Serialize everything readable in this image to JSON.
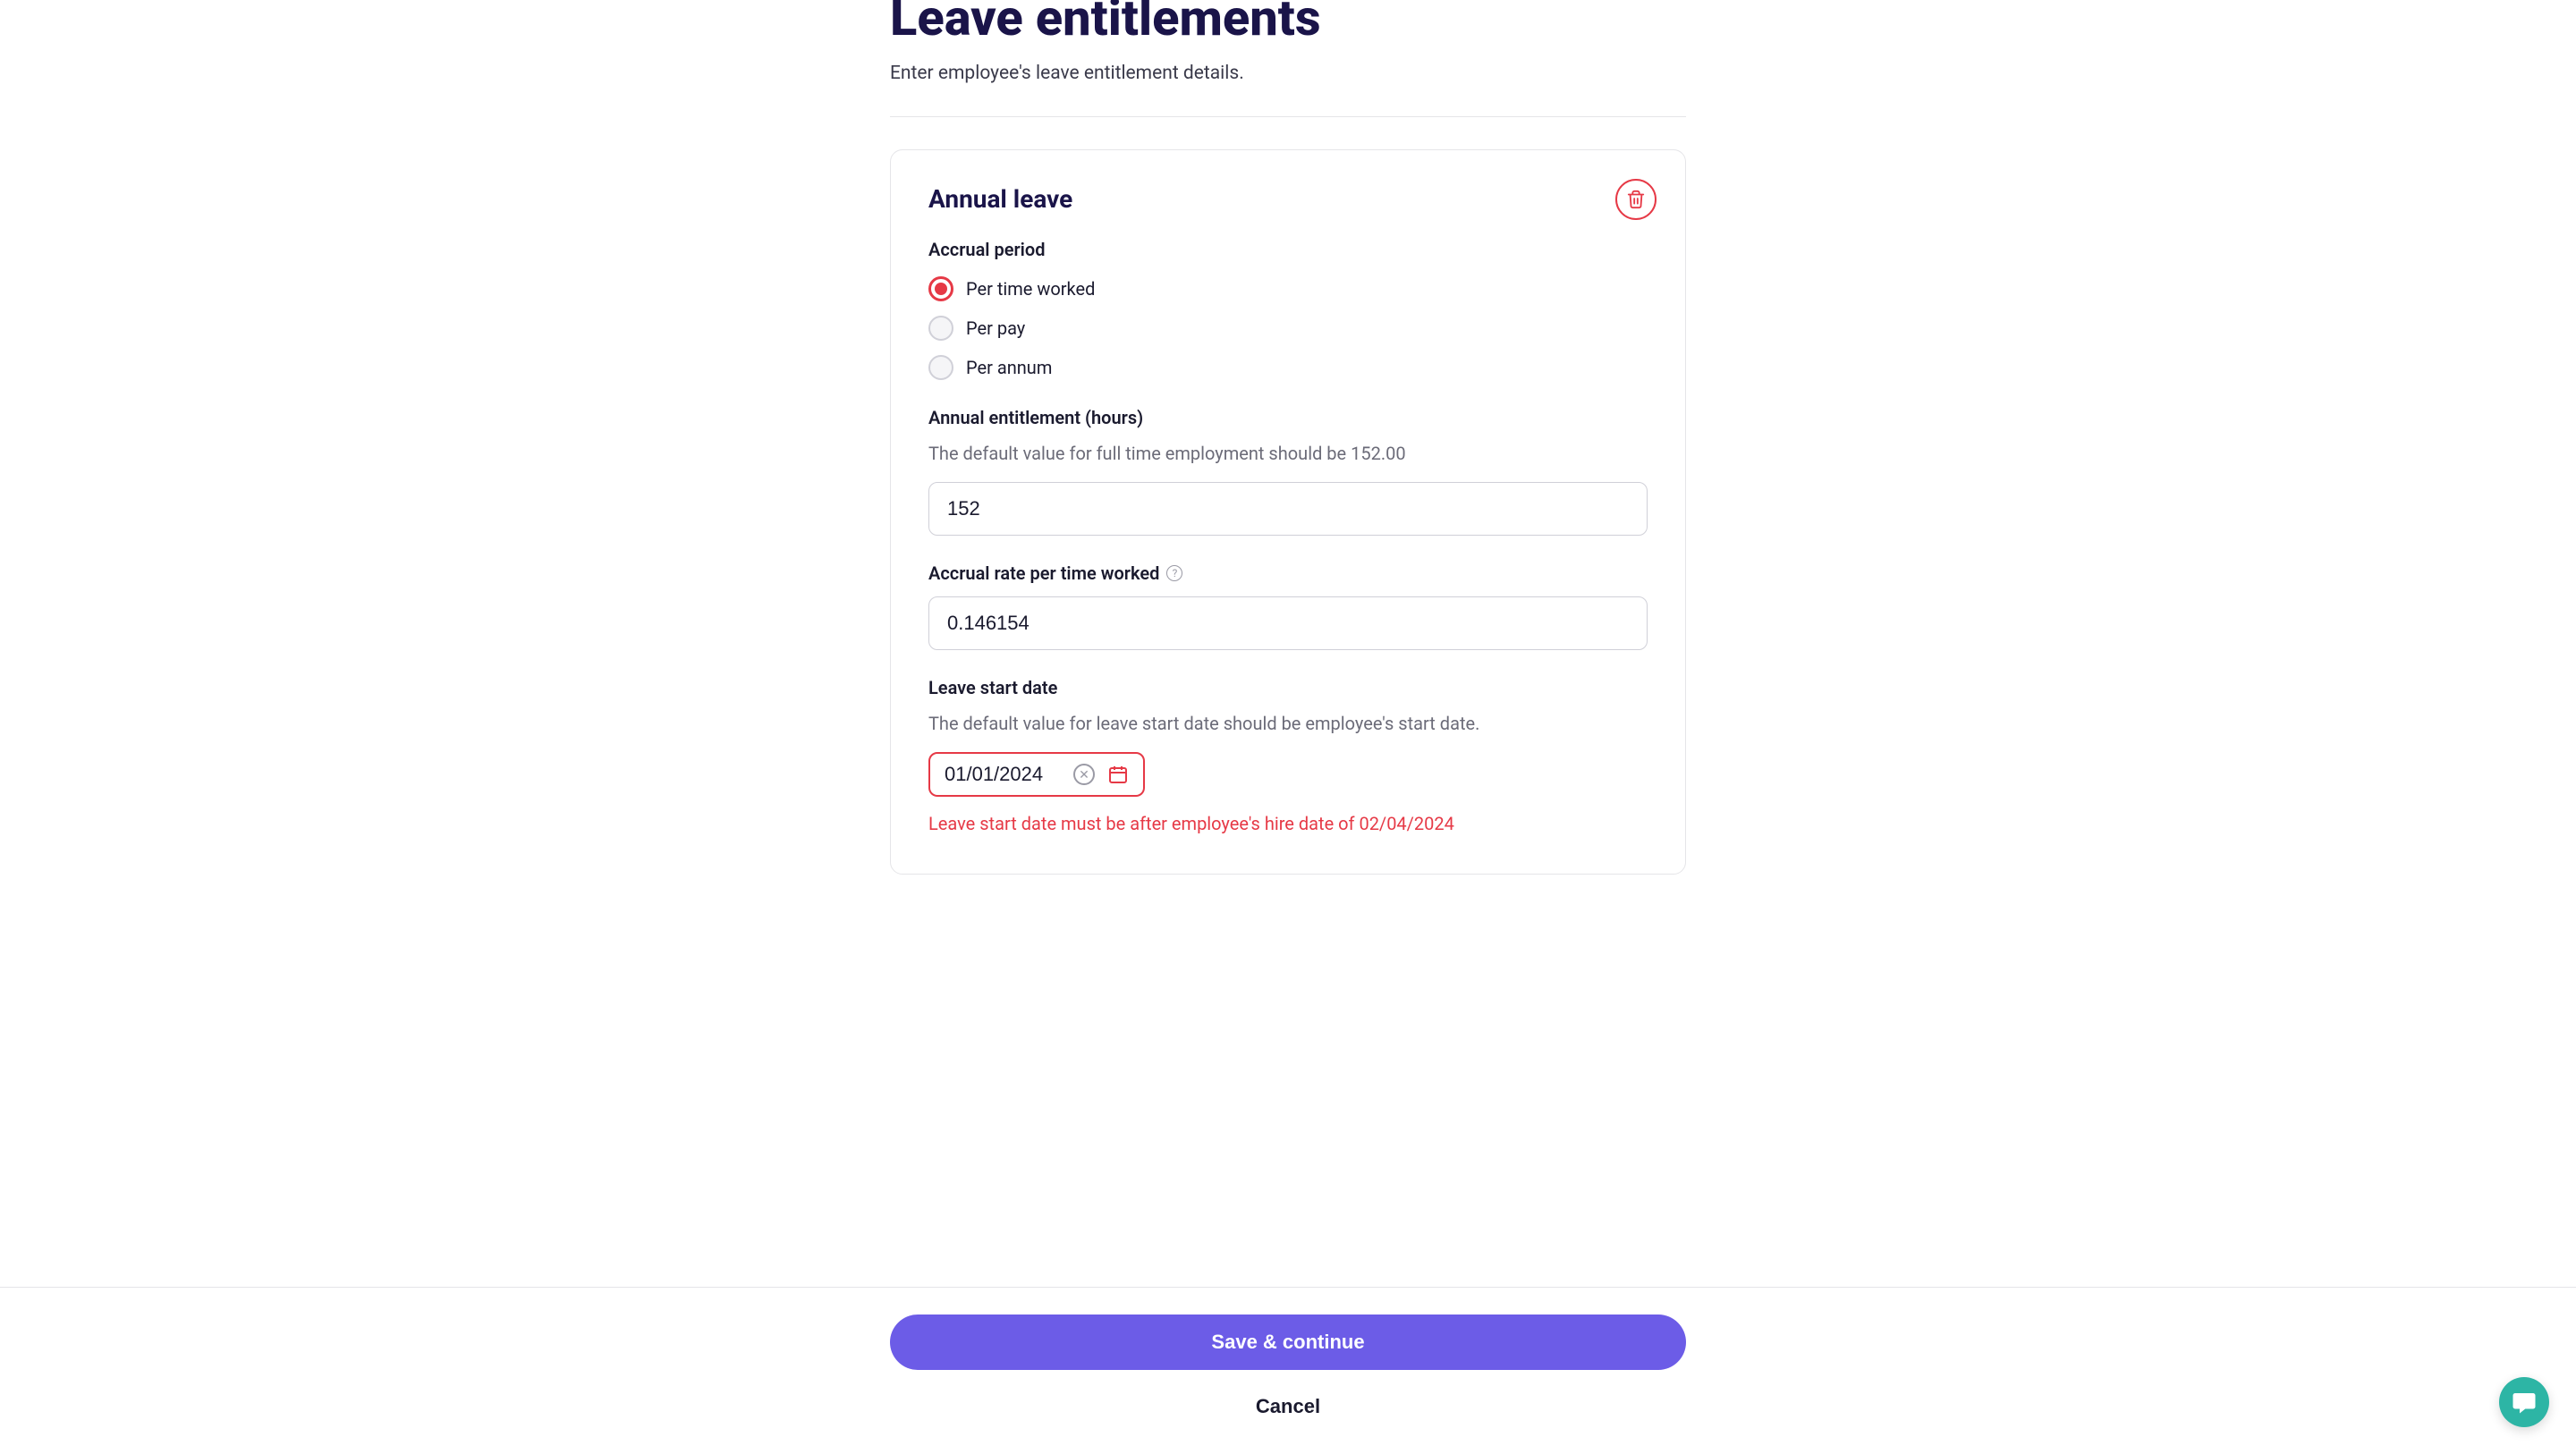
{
  "page": {
    "title": "Leave entitlements",
    "subtitle": "Enter employee's leave entitlement details."
  },
  "card": {
    "title": "Annual leave"
  },
  "accrual_period": {
    "label": "Accrual period",
    "options": [
      {
        "label": "Per time worked",
        "selected": true
      },
      {
        "label": "Per pay",
        "selected": false
      },
      {
        "label": "Per annum",
        "selected": false
      }
    ]
  },
  "annual_entitlement": {
    "label": "Annual entitlement (hours)",
    "help": "The default value for full time employment should be 152.00",
    "value": "152"
  },
  "accrual_rate": {
    "label": "Accrual rate per time worked",
    "value": "0.146154"
  },
  "leave_start": {
    "label": "Leave start date",
    "help": "The default value for leave start date should be employee's start date.",
    "value": "01/01/2024",
    "error": "Leave start date must be after employee's hire date of 02/04/2024"
  },
  "footer": {
    "save": "Save & continue",
    "cancel": "Cancel"
  },
  "colors": {
    "primary": "#6c5ce7",
    "danger": "#e63946",
    "heading": "#1a1449",
    "chat": "#2db5a5"
  }
}
